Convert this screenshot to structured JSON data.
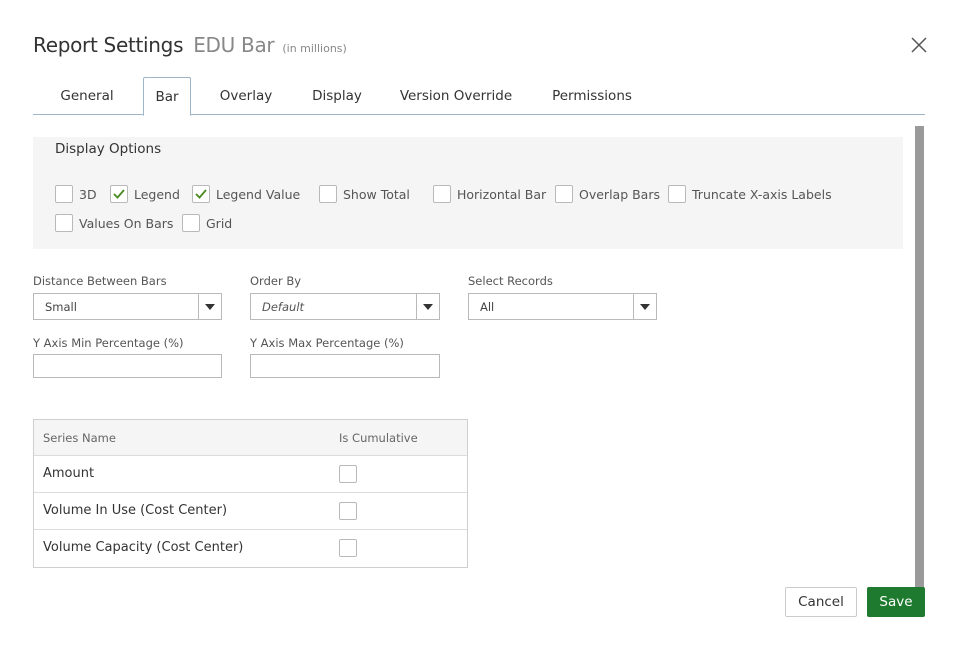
{
  "header": {
    "title": "Report Settings",
    "report_name": "EDU Bar",
    "unit_note": "(in millions)"
  },
  "tabs": [
    {
      "label": "General",
      "active": false
    },
    {
      "label": "Bar",
      "active": true
    },
    {
      "label": "Overlay",
      "active": false
    },
    {
      "label": "Display",
      "active": false
    },
    {
      "label": "Version Override",
      "active": false
    },
    {
      "label": "Permissions",
      "active": false
    }
  ],
  "display_options": {
    "title": "Display Options",
    "options": [
      {
        "label": "3D",
        "checked": false
      },
      {
        "label": "Legend",
        "checked": true
      },
      {
        "label": "Legend Value",
        "checked": true
      },
      {
        "label": "Show Total",
        "checked": false
      },
      {
        "label": "Horizontal Bar",
        "checked": false
      },
      {
        "label": "Overlap Bars",
        "checked": false
      },
      {
        "label": "Truncate X-axis Labels",
        "checked": false
      },
      {
        "label": "Values On Bars",
        "checked": false
      },
      {
        "label": "Grid",
        "checked": false
      }
    ]
  },
  "fields": {
    "distance_between_bars": {
      "label": "Distance Between Bars",
      "value": "Small"
    },
    "order_by": {
      "label": "Order By",
      "value": "Default"
    },
    "select_records": {
      "label": "Select Records",
      "value": "All"
    },
    "y_axis_min": {
      "label": "Y Axis Min Percentage (%)",
      "value": ""
    },
    "y_axis_max": {
      "label": "Y Axis Max Percentage (%)",
      "value": ""
    }
  },
  "series_table": {
    "columns": [
      "Series Name",
      "Is Cumulative"
    ],
    "rows": [
      {
        "name": "Amount",
        "cumulative": false
      },
      {
        "name": "Volume In Use (Cost Center)",
        "cumulative": false
      },
      {
        "name": "Volume Capacity (Cost Center)",
        "cumulative": false
      }
    ]
  },
  "buttons": {
    "cancel": "Cancel",
    "save": "Save"
  },
  "colors": {
    "save": "#1e7a2e",
    "checkmark": "#4a8a1e",
    "tab_border": "#9fb5c8",
    "panel_bg": "#f5f5f5"
  },
  "icons": {
    "close": "close-icon",
    "dropdown": "caret-down-icon",
    "check": "checkmark-icon"
  }
}
